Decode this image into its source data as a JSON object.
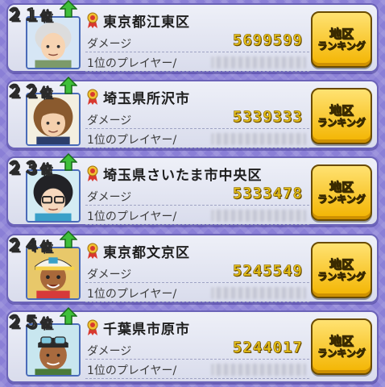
{
  "rows": [
    {
      "rank": "２１",
      "rank_suffix": "位",
      "region": "東京都江東区",
      "damage_label": "ダメージ",
      "damage": "5699599",
      "player_label": "1位のプレイヤー/",
      "button_line1": "地区",
      "button_line2": "ランキング",
      "avatar": "old-woman"
    },
    {
      "rank": "２２",
      "rank_suffix": "位",
      "region": "埼玉県所沢市",
      "damage_label": "ダメージ",
      "damage": "5339333",
      "player_label": "1位のプレイヤー/",
      "button_line1": "地区",
      "button_line2": "ランキング",
      "avatar": "brown-hair-girl"
    },
    {
      "rank": "２３",
      "rank_suffix": "位",
      "region": "埼玉県さいたま市中央区",
      "damage_label": "ダメージ",
      "damage": "5333478",
      "player_label": "1位のプレイヤー/",
      "button_line1": "地区",
      "button_line2": "ランキング",
      "avatar": "glasses-girl"
    },
    {
      "rank": "２４",
      "rank_suffix": "位",
      "region": "東京都文京区",
      "damage_label": "ダメージ",
      "damage": "5245549",
      "player_label": "1位のプレイヤー/",
      "button_line1": "地区",
      "button_line2": "ランキング",
      "avatar": "cap-boy"
    },
    {
      "rank": "２５",
      "rank_suffix": "位",
      "region": "千葉県市原市",
      "damage_label": "ダメージ",
      "damage": "5244017",
      "player_label": "1位のプレイヤー/",
      "button_line1": "地区",
      "button_line2": "ランキング",
      "avatar": "goggles-man"
    }
  ],
  "colors": {
    "arrow": "#3fbf3a",
    "button": "#f3b400",
    "damage": "#e8c21a",
    "ribbon": "#d8382f"
  }
}
